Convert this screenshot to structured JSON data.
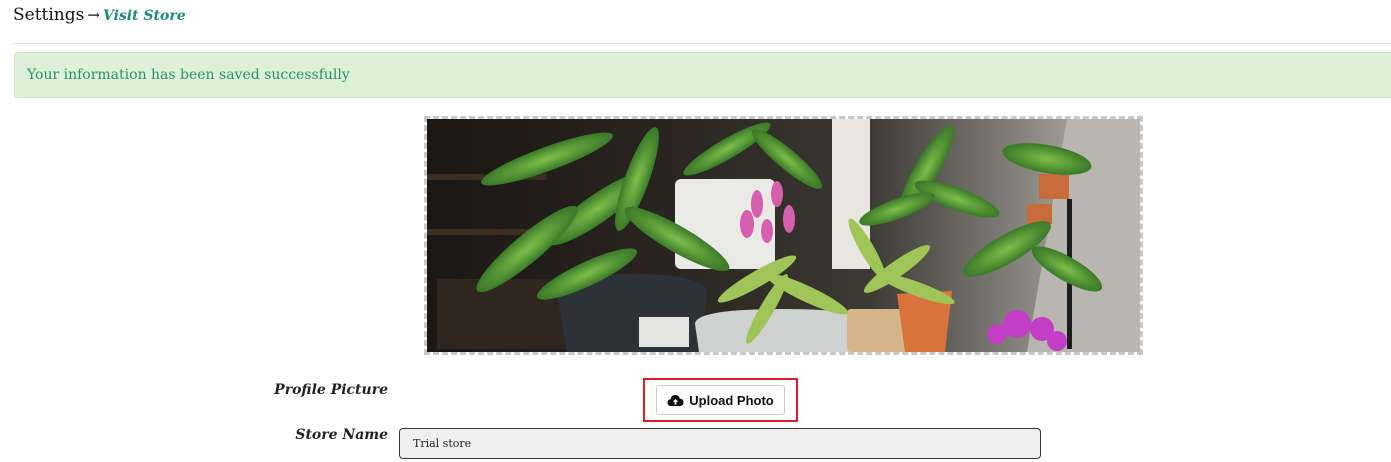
{
  "breadcrumb": {
    "root": "Settings",
    "separator": "→",
    "link": "Visit Store"
  },
  "alert": {
    "message": "Your information has been saved successfully"
  },
  "banner": {
    "image_alt": "potted plants"
  },
  "form": {
    "profile_picture_label": "Profile Picture",
    "upload_button_label": "Upload Photo",
    "store_name_label": "Store Name",
    "store_name_value": "Trial store"
  },
  "colors": {
    "link": "#1b8a78",
    "alert_bg": "#dff0d8",
    "alert_text": "#2a8f6a",
    "highlight": "#d32029"
  },
  "icons": {
    "upload": "cloud-upload-icon"
  }
}
